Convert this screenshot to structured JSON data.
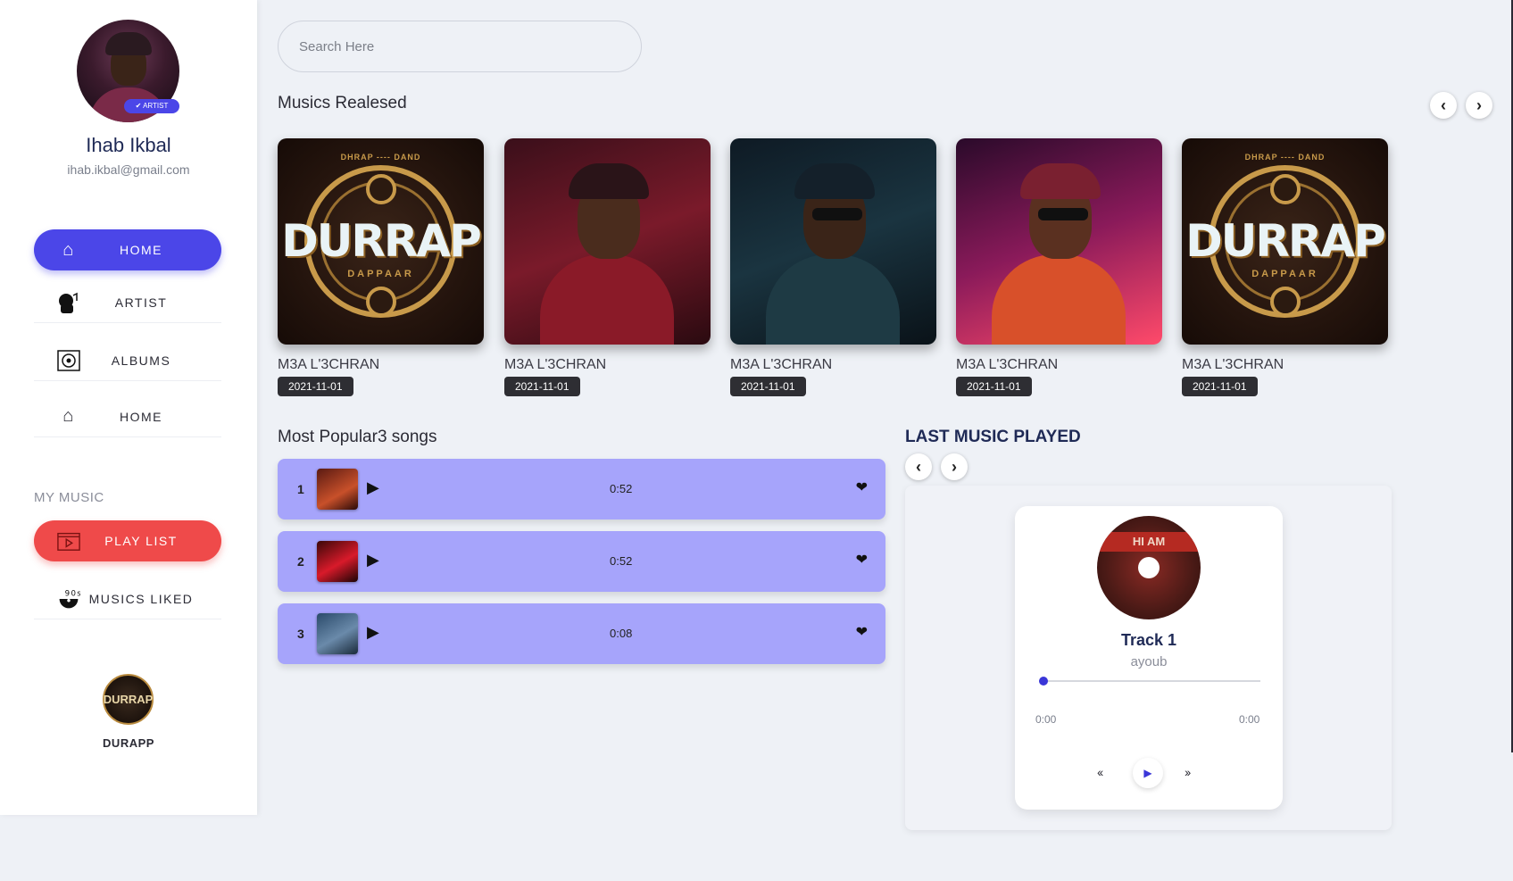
{
  "profile": {
    "name": "Ihab Ikbal",
    "email": "ihab.ikbal@gmail.com",
    "badge": "✔ ARTIST"
  },
  "nav": [
    {
      "label": "HOME",
      "icon": "home-icon"
    },
    {
      "label": "ARTIST",
      "icon": "artist-icon"
    },
    {
      "label": "ALBUMS",
      "icon": "album-icon"
    },
    {
      "label": "HOME",
      "icon": "home-icon"
    }
  ],
  "my_music": {
    "title": "MY MUSIC",
    "items": [
      {
        "label": "PLAY LIST",
        "icon": "playlist-icon"
      },
      {
        "label": "MUSICS LIKED",
        "icon": "vinyl-90s-icon"
      }
    ]
  },
  "brand": {
    "name": "DURAPP",
    "logo_text": "DURRAP"
  },
  "search": {
    "placeholder": "Search Here"
  },
  "releases": {
    "title": "Musics Realesed",
    "items": [
      {
        "title": "M3A L'3CHRAN",
        "date": "2021-11-01",
        "cover": "durrap-logo"
      },
      {
        "title": "M3A L'3CHRAN",
        "date": "2021-11-01",
        "cover": "artist-red-hood"
      },
      {
        "title": "M3A L'3CHRAN",
        "date": "2021-11-01",
        "cover": "artist-teal-jacket"
      },
      {
        "title": "M3A L'3CHRAN",
        "date": "2021-11-01",
        "cover": "artist-pink-glasses"
      },
      {
        "title": "M3A L'3CHRAN",
        "date": "2021-11-01",
        "cover": "durrap-logo"
      }
    ],
    "logo_text": {
      "top": "DHRAP ---- DAND",
      "word": "DURRAP",
      "sub": "DAPPAAR"
    }
  },
  "popular": {
    "title": "Most Popular3 songs",
    "songs": [
      {
        "rank": "1",
        "duration": "0:52"
      },
      {
        "rank": "2",
        "duration": "0:52"
      },
      {
        "rank": "3",
        "duration": "0:08"
      }
    ]
  },
  "last_played": {
    "title": "LAST MUSIC PLAYED",
    "disc_label": "HI AM",
    "track": "Track 1",
    "artist": "ayoub",
    "current_time": "0:00",
    "total_time": "0:00",
    "progress": 0
  },
  "colors": {
    "accent": "#4b46e8",
    "danger": "#ef4a4a",
    "song_row": "#a6a4fb"
  }
}
